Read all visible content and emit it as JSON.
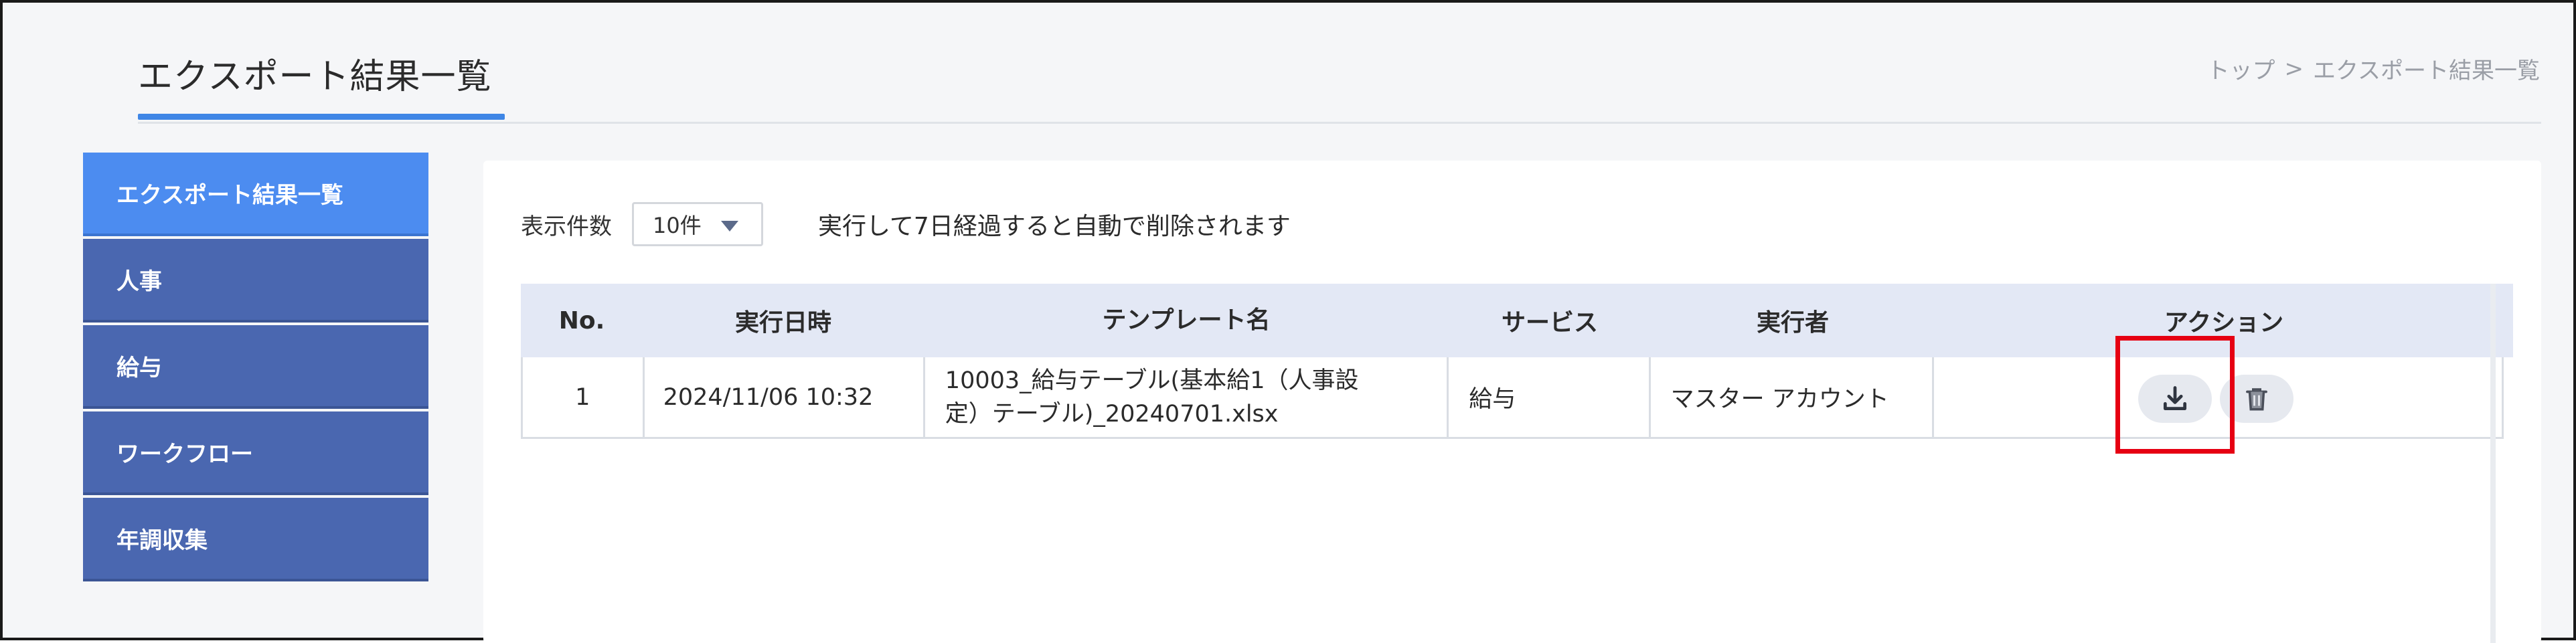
{
  "header": {
    "title": "エクスポート結果一覧",
    "breadcrumb": {
      "home": "トップ",
      "separator": ">",
      "current": "エクスポート結果一覧"
    }
  },
  "sidebar": {
    "items": [
      {
        "label": "エクスポート結果一覧",
        "active": true
      },
      {
        "label": "人事",
        "active": false
      },
      {
        "label": "給与",
        "active": false
      },
      {
        "label": "ワークフロー",
        "active": false
      },
      {
        "label": "年調収集",
        "active": false
      }
    ]
  },
  "toolbar": {
    "per_page_label": "表示件数",
    "per_page_value": "10件",
    "notice": "実行して7日経過すると自動で削除されます"
  },
  "table": {
    "columns": [
      "No.",
      "実行日時",
      "テンプレート名",
      "サービス",
      "実行者",
      "アクション"
    ],
    "rows": [
      {
        "no": "1",
        "datetime": "2024/11/06 10:32",
        "template_line1": "10003_給与テーブル(基本給1（人事設",
        "template_line2": "定）テーブル)_20240701.xlsx",
        "service": "給与",
        "user": "マスター アカウント"
      }
    ]
  },
  "icons": {
    "download": "download-icon",
    "delete": "trash-icon"
  },
  "colors": {
    "accent": "#3f86e6",
    "sidebar": "#4a67b0",
    "sidebar_active": "#4c8cf0",
    "table_header": "#e3e8f5",
    "highlight": "#e60012"
  }
}
